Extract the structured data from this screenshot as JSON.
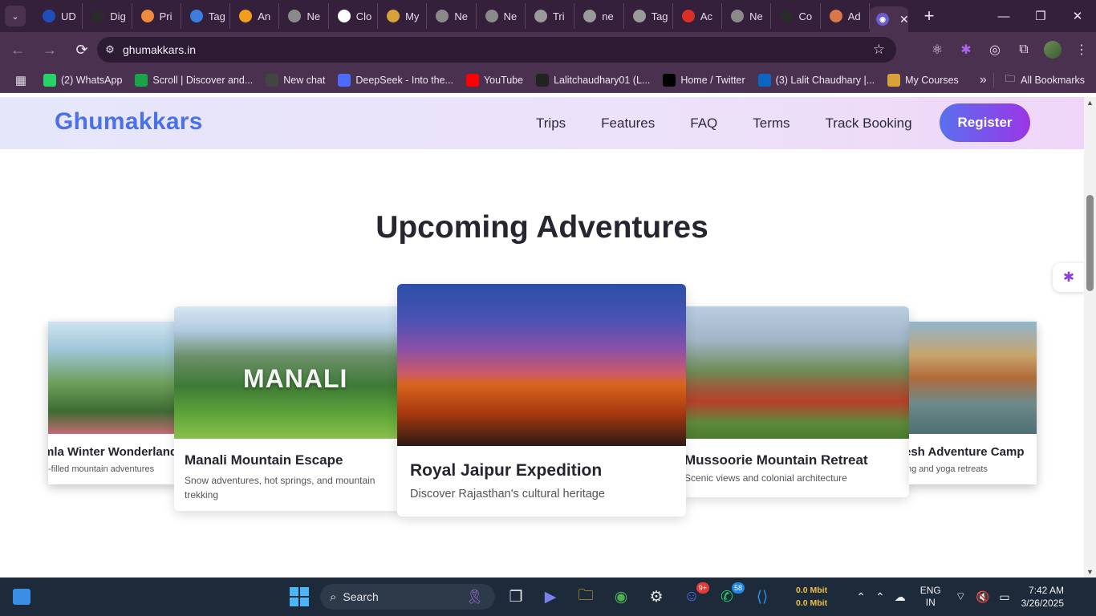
{
  "browser": {
    "tabs": [
      {
        "label": "UD",
        "icon": "ud-icon",
        "color": "#1e4fb8"
      },
      {
        "label": "Dig",
        "icon": "openai-icon",
        "color": "#2b2b2b"
      },
      {
        "label": "Pri",
        "icon": "pointer-icon",
        "color": "#f08a3c"
      },
      {
        "label": "Tag",
        "icon": "tag-icon",
        "color": "#3b7ee0"
      },
      {
        "label": "An",
        "icon": "analytics-icon",
        "color": "#f29d1b"
      },
      {
        "label": "Ne",
        "icon": "globe-icon",
        "color": "#8a8a8a"
      },
      {
        "label": "Clo",
        "icon": "cloud-icon",
        "color": "#ffffff"
      },
      {
        "label": "My",
        "icon": "udemy-icon",
        "color": "#d8a23a"
      },
      {
        "label": "Ne",
        "icon": "globe-icon",
        "color": "#8a8a8a"
      },
      {
        "label": "Ne",
        "icon": "globe-icon",
        "color": "#8a8a8a"
      },
      {
        "label": "Tri",
        "icon": "render-icon",
        "color": "#9a9a9a"
      },
      {
        "label": "ne",
        "icon": "render-icon",
        "color": "#9a9a9a"
      },
      {
        "label": "Tag",
        "icon": "render-icon",
        "color": "#9a9a9a"
      },
      {
        "label": "Ac",
        "icon": "gmail-icon",
        "color": "#d93025"
      },
      {
        "label": "Ne",
        "icon": "globe-icon",
        "color": "#8a8a8a"
      },
      {
        "label": "Co",
        "icon": "openai-icon",
        "color": "#2b2b2b"
      },
      {
        "label": "Ad",
        "icon": "claude-icon",
        "color": "#d9774b"
      }
    ],
    "active_tab_close": "✕",
    "new_tab": "+",
    "url": "ghumakkars.in",
    "bookmarks": [
      {
        "label": "(2) WhatsApp",
        "icon": "whatsapp-icon",
        "color": "#25d366"
      },
      {
        "label": "Scroll | Discover and...",
        "icon": "scroll-icon",
        "color": "#1aa34a"
      },
      {
        "label": "New chat",
        "icon": "openai-icon",
        "color": "#444444"
      },
      {
        "label": "DeepSeek - Into the...",
        "icon": "deepseek-icon",
        "color": "#4d6bfe"
      },
      {
        "label": "YouTube",
        "icon": "youtube-icon",
        "color": "#ff0000"
      },
      {
        "label": "Lalitchaudhary01 (L...",
        "icon": "github-icon",
        "color": "#222222"
      },
      {
        "label": "Home / Twitter",
        "icon": "x-icon",
        "color": "#000000"
      },
      {
        "label": "(3) Lalit Chaudhary |...",
        "icon": "linkedin-icon",
        "color": "#0a66c2"
      },
      {
        "label": "My Courses",
        "icon": "udemy-icon",
        "color": "#d8a23a"
      }
    ],
    "all_bookmarks": "All Bookmarks"
  },
  "site": {
    "logo": "Ghumakkars",
    "nav": [
      "Trips",
      "Features",
      "FAQ",
      "Terms",
      "Track Booking"
    ],
    "register": "Register",
    "section_title": "Upcoming Adventures",
    "cards": {
      "shimla": {
        "title": "mla Winter Wonderland",
        "desc": "-filled mountain adventures"
      },
      "manali": {
        "title": "Manali Mountain Escape",
        "desc": "Snow adventures, hot springs, and mountain trekking",
        "overlay": "MANALI"
      },
      "jaipur": {
        "title": "Royal Jaipur Expedition",
        "desc": "Discover Rajasthan's cultural heritage"
      },
      "mussoorie": {
        "title": "Mussoorie Mountain Retreat",
        "desc": "Scenic views and colonial architecture"
      },
      "rishikesh": {
        "title": "esh Adventure Camp",
        "desc": "ng and yoga retreats"
      }
    }
  },
  "taskbar": {
    "search": "Search",
    "whatsapp_badge": "58",
    "discord_badge": "9+",
    "net_up": "0.0 Mbit",
    "net_down": "0.0 Mbit",
    "lang_top": "ENG",
    "lang_bottom": "IN",
    "time": "7:42 AM",
    "date": "3/26/2025"
  }
}
